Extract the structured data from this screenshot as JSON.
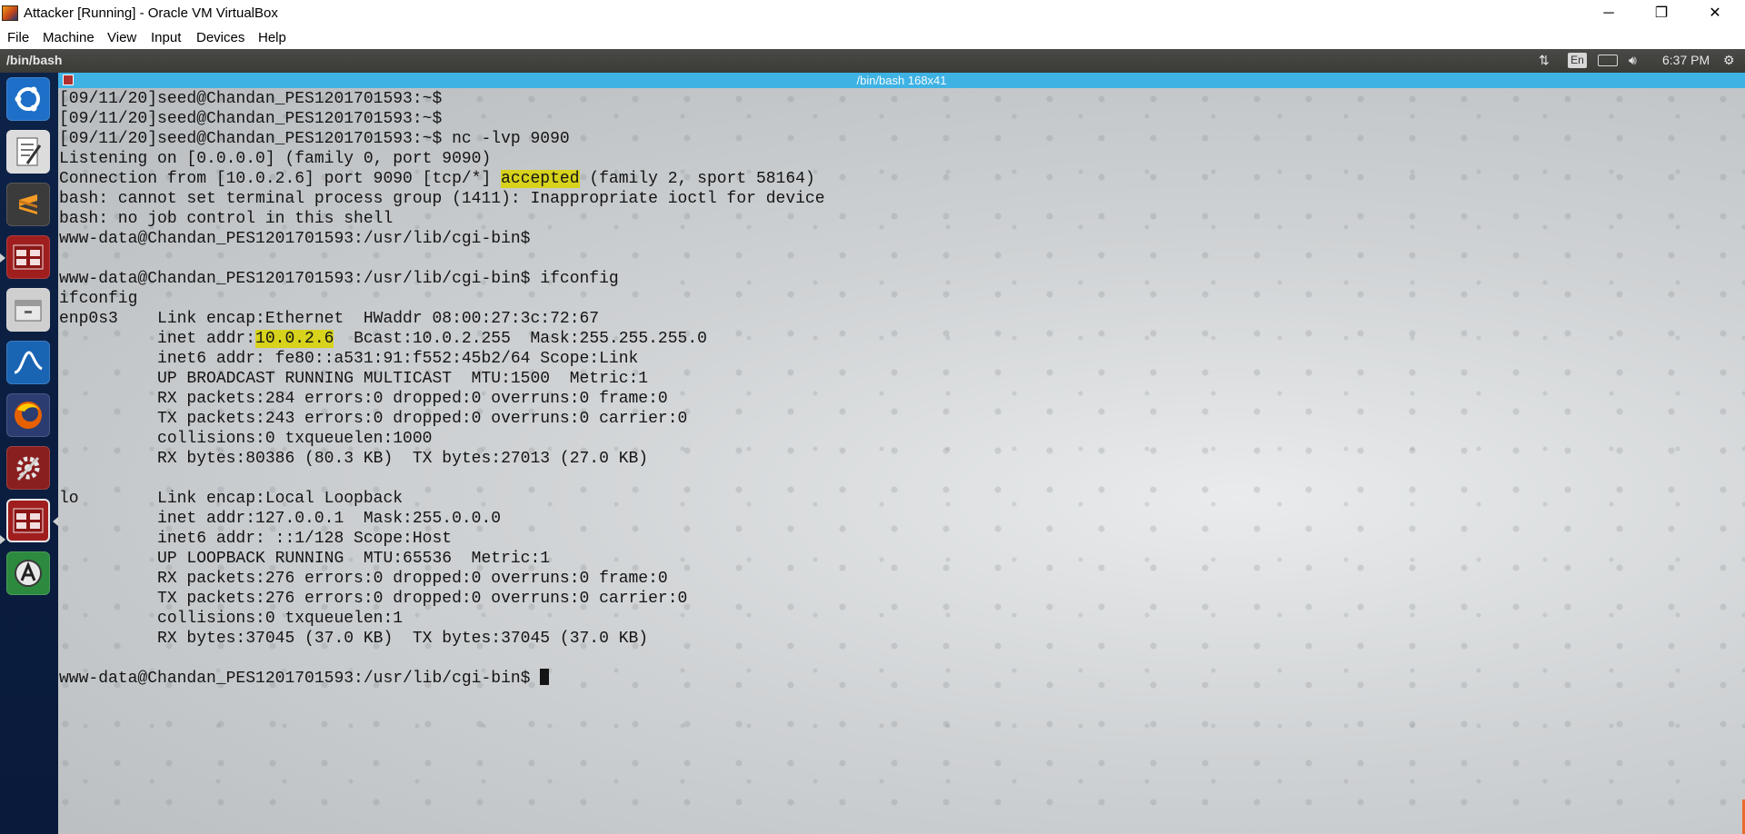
{
  "window": {
    "title": "Attacker [Running] - Oracle VM VirtualBox",
    "controls": {
      "minimize": "─",
      "restore": "❐",
      "close": "✕"
    }
  },
  "menubar": {
    "items": [
      "File",
      "Machine",
      "View",
      "Input",
      "Devices",
      "Help"
    ]
  },
  "top_panel": {
    "title": "/bin/bash",
    "keyboard_layout": "En",
    "time": "6:37 PM",
    "icons": [
      "network-transfer-icon",
      "keyboard-layout-icon",
      "battery-icon",
      "volume-icon",
      "system-gear-icon"
    ]
  },
  "launcher": {
    "items": [
      {
        "name": "ubuntu-dash-icon",
        "color": "#1e6fc7"
      },
      {
        "name": "text-editor-icon",
        "color": "#d9d9d9"
      },
      {
        "name": "sublime-text-icon",
        "color": "#3b3b3b"
      },
      {
        "name": "terminal-app-icon",
        "color": "#a01e1e"
      },
      {
        "name": "file-manager-icon",
        "color": "#cfcfcf"
      },
      {
        "name": "wireshark-icon",
        "color": "#1a64b4"
      },
      {
        "name": "firefox-icon",
        "color": "#e66000"
      },
      {
        "name": "settings-icon",
        "color": "#8a1f1f"
      },
      {
        "name": "terminal-app-active-icon",
        "color": "#a01e1e"
      },
      {
        "name": "software-updater-icon",
        "color": "#2b8a3e"
      }
    ]
  },
  "terminal": {
    "title": "/bin/bash 168x41",
    "lines": [
      "[09/11/20]seed@Chandan_PES1201701593:~$",
      "[09/11/20]seed@Chandan_PES1201701593:~$",
      "[09/11/20]seed@Chandan_PES1201701593:~$ nc -lvp 9090",
      "Listening on [0.0.0.0] (family 0, port 9090)",
      {
        "pre": "Connection from [10.0.2.6] port 9090 [tcp/*] ",
        "hl": "accepted",
        "post": " (family 2, sport 58164)"
      },
      "bash: cannot set terminal process group (1411): Inappropriate ioctl for device",
      "bash: no job control in this shell",
      "www-data@Chandan_PES1201701593:/usr/lib/cgi-bin$",
      "",
      "www-data@Chandan_PES1201701593:/usr/lib/cgi-bin$ ifconfig",
      "ifconfig",
      "enp0s3    Link encap:Ethernet  HWaddr 08:00:27:3c:72:67",
      {
        "pre": "          inet addr:",
        "hl": "10.0.2.6",
        "post": "  Bcast:10.0.2.255  Mask:255.255.255.0"
      },
      "          inet6 addr: fe80::a531:91:f552:45b2/64 Scope:Link",
      "          UP BROADCAST RUNNING MULTICAST  MTU:1500  Metric:1",
      "          RX packets:284 errors:0 dropped:0 overruns:0 frame:0",
      "          TX packets:243 errors:0 dropped:0 overruns:0 carrier:0",
      "          collisions:0 txqueuelen:1000",
      "          RX bytes:80386 (80.3 KB)  TX bytes:27013 (27.0 KB)",
      "",
      "lo        Link encap:Local Loopback",
      "          inet addr:127.0.0.1  Mask:255.0.0.0",
      "          inet6 addr: ::1/128 Scope:Host",
      "          UP LOOPBACK RUNNING  MTU:65536  Metric:1",
      "          RX packets:276 errors:0 dropped:0 overruns:0 frame:0",
      "          TX packets:276 errors:0 dropped:0 overruns:0 carrier:0",
      "          collisions:0 txqueuelen:1",
      "          RX bytes:37045 (37.0 KB)  TX bytes:37045 (37.0 KB)",
      "",
      {
        "pre": "www-data@Chandan_PES1201701593:/usr/lib/cgi-bin$ ",
        "cursor": true
      }
    ]
  }
}
